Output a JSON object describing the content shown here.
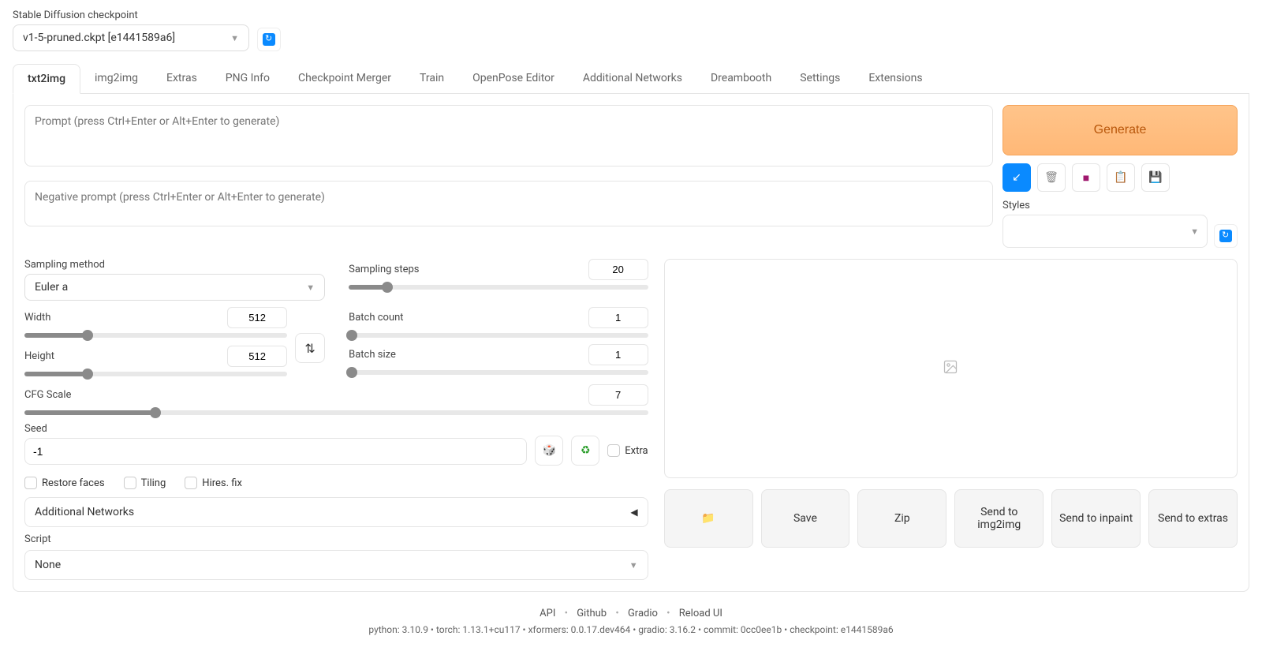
{
  "checkpoint": {
    "label": "Stable Diffusion checkpoint",
    "value": "v1-5-pruned.ckpt [e1441589a6]"
  },
  "tabs": [
    "txt2img",
    "img2img",
    "Extras",
    "PNG Info",
    "Checkpoint Merger",
    "Train",
    "OpenPose Editor",
    "Additional Networks",
    "Dreambooth",
    "Settings",
    "Extensions"
  ],
  "active_tab": "txt2img",
  "prompt": {
    "placeholder": "Prompt (press Ctrl+Enter or Alt+Enter to generate)",
    "value": ""
  },
  "neg_prompt": {
    "placeholder": "Negative prompt (press Ctrl+Enter or Alt+Enter to generate)",
    "value": ""
  },
  "generate_label": "Generate",
  "styles_label": "Styles",
  "sampling_method": {
    "label": "Sampling method",
    "value": "Euler a"
  },
  "sampling_steps": {
    "label": "Sampling steps",
    "value": "20",
    "pct": 13
  },
  "width": {
    "label": "Width",
    "value": "512",
    "pct": 24
  },
  "height": {
    "label": "Height",
    "value": "512",
    "pct": 24
  },
  "batch_count": {
    "label": "Batch count",
    "value": "1",
    "pct": 0
  },
  "batch_size": {
    "label": "Batch size",
    "value": "1",
    "pct": 0
  },
  "cfg": {
    "label": "CFG Scale",
    "value": "7",
    "pct": 21
  },
  "seed": {
    "label": "Seed",
    "value": "-1"
  },
  "extra_label": "Extra",
  "checkboxes": {
    "restore": "Restore faces",
    "tiling": "Tiling",
    "hires": "Hires. fix"
  },
  "accordion": "Additional Networks",
  "script": {
    "label": "Script",
    "value": "None"
  },
  "actions": {
    "folder": "📁",
    "save": "Save",
    "zip": "Zip",
    "img2img": "Send to img2img",
    "inpaint": "Send to inpaint",
    "extras": "Send to extras"
  },
  "footer": {
    "links": [
      "API",
      "Github",
      "Gradio",
      "Reload UI"
    ],
    "versions": "python: 3.10.9  •  torch: 1.13.1+cu117  •  xformers: 0.0.17.dev464  •  gradio: 3.16.2  •  commit: 0cc0ee1b  •  checkpoint: e1441589a6"
  },
  "icons": {
    "arrow": "↙",
    "trash": "🗑",
    "bookmark": "🔖",
    "clipboard": "📋",
    "save_disk": "💾",
    "dice": "🎲",
    "recycle": "♻",
    "swap": "⇅",
    "image": "🖼"
  }
}
